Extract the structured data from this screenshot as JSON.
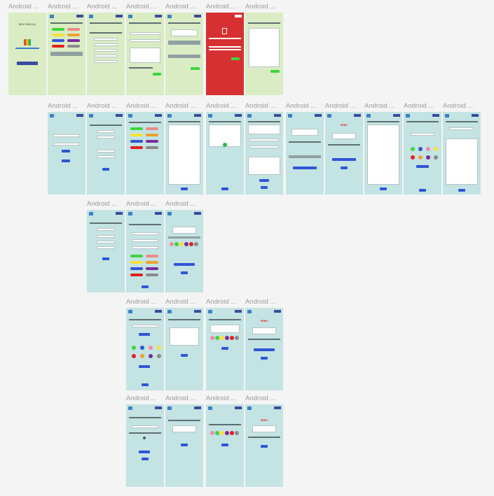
{
  "frames": [
    {
      "title": "Android ..."
    },
    {
      "title": "Android ..."
    },
    {
      "title": "Android ..."
    },
    {
      "title": "Android ..."
    },
    {
      "title": "Android ..."
    },
    {
      "title": "Android ..."
    },
    {
      "title": "Android ..."
    },
    {
      "title": "Android ..."
    },
    {
      "title": "Android ..."
    },
    {
      "title": "Android ..."
    },
    {
      "title": "Android ..."
    },
    {
      "title": "Android ..."
    },
    {
      "title": "Android ..."
    },
    {
      "title": "Android ..."
    },
    {
      "title": "Android ..."
    },
    {
      "title": "Android ..."
    },
    {
      "title": "Android ..."
    },
    {
      "title": "Android ..."
    },
    {
      "title": "Android ..."
    },
    {
      "title": "Android ..."
    },
    {
      "title": "Android ..."
    },
    {
      "title": "Android ..."
    },
    {
      "title": "Android ..."
    },
    {
      "title": "Android ..."
    },
    {
      "title": "Android ..."
    },
    {
      "title": "Android ..."
    },
    {
      "title": "Android ..."
    },
    {
      "title": "Android ..."
    },
    {
      "title": "Android ..."
    }
  ],
  "screen_titles": {
    "welcome": "BEM VINDO(A)",
    "error": "ERRO"
  },
  "colors": {
    "green_screen": "#d9ecc4",
    "teal_screen": "#c4e3e3",
    "red_screen": "#d63030",
    "primary_button": "#2e56d6",
    "confirm_button": "#3dd63d"
  }
}
